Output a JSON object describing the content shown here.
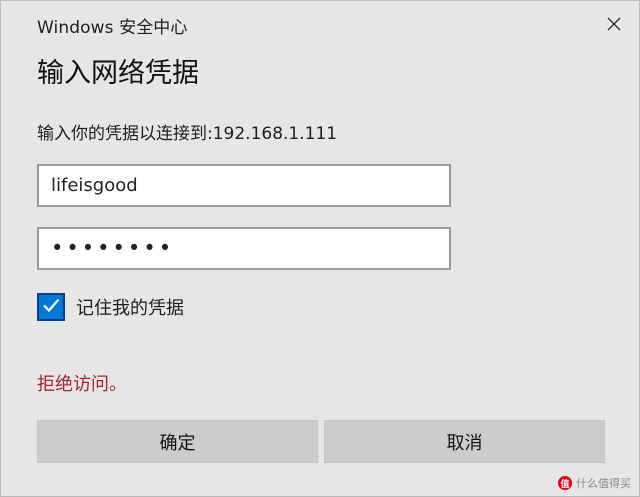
{
  "window": {
    "title": "Windows 安全中心",
    "close_icon": "close-icon"
  },
  "dialog": {
    "heading": "输入网络凭据",
    "prompt": "输入你的凭据以连接到:192.168.1.111"
  },
  "form": {
    "username_value": "lifeisgood",
    "password_display": "••••••••",
    "remember_label": "记住我的凭据",
    "remember_checked": true
  },
  "status": {
    "error_message": "拒绝访问。",
    "error_color": "#a4262c"
  },
  "buttons": {
    "ok_label": "确定",
    "cancel_label": "取消"
  },
  "colors": {
    "accent": "#0078d7",
    "dialog_bg": "#e6e6e6",
    "button_bg": "#cccccc"
  },
  "watermark": {
    "text": "什么值得买",
    "logo_glyph": "值"
  }
}
